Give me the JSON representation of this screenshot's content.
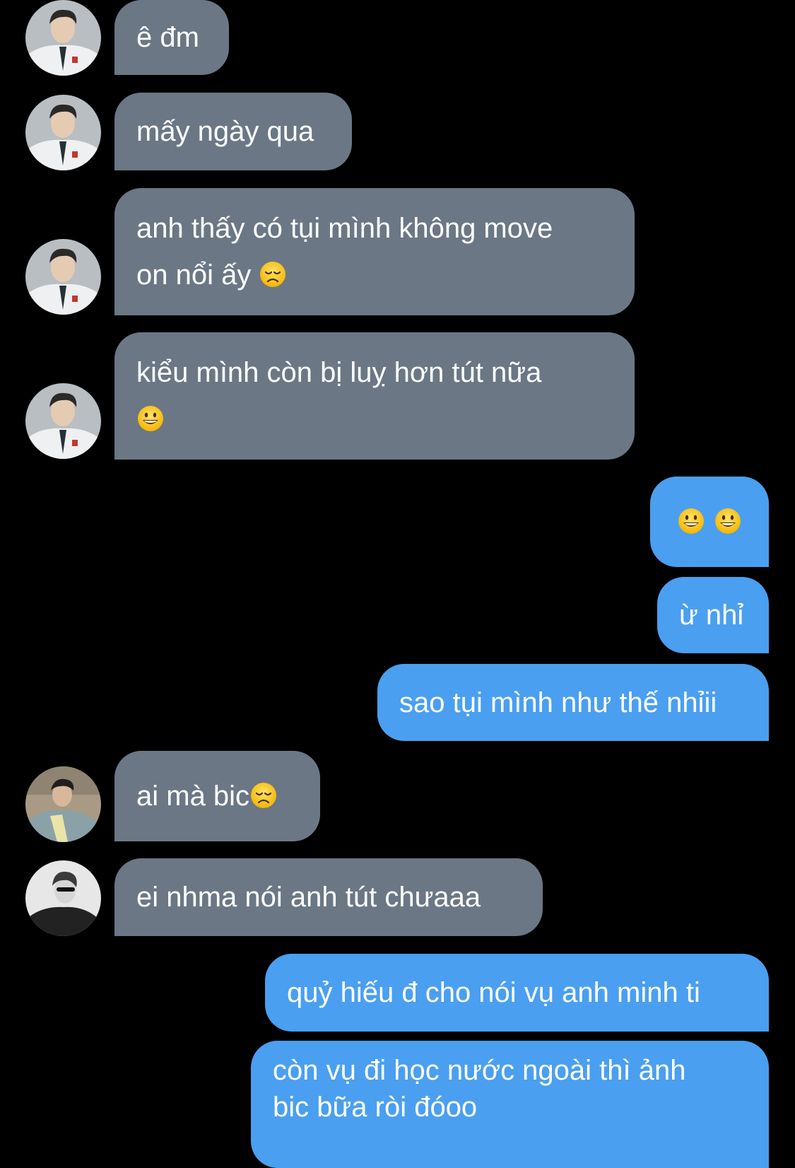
{
  "conversation": {
    "messages": [
      {
        "text": "ê đm"
      },
      {
        "text": "mấy ngày qua"
      },
      {
        "text": "anh thấy có tụi mình không move\non nổi ấy "
      },
      {
        "text": "kiểu mình còn bị luỵ hơn tút nữa\n"
      },
      {
        "text": " "
      },
      {
        "text": "ừ nhỉ"
      },
      {
        "text": "sao tụi mình như thế nhỉii"
      },
      {
        "text": "ai mà bic"
      },
      {
        "text": "ei nhma nói anh tút chưaaa"
      },
      {
        "text": "quỷ hiếu đ cho nói vụ anh minh ti"
      },
      {
        "text": "còn vụ đi học nước ngoài thì ảnh\nbic bữa ròi đóoo"
      }
    ],
    "emoji": {
      "disappointed": "disappointed-face-emoji",
      "grinning": "grinning-face-emoji"
    }
  },
  "colors": {
    "background": "#000000",
    "incoming_bubble": "#6b7785",
    "outgoing_bubble": "#4a9ff0",
    "text": "#ffffff"
  }
}
